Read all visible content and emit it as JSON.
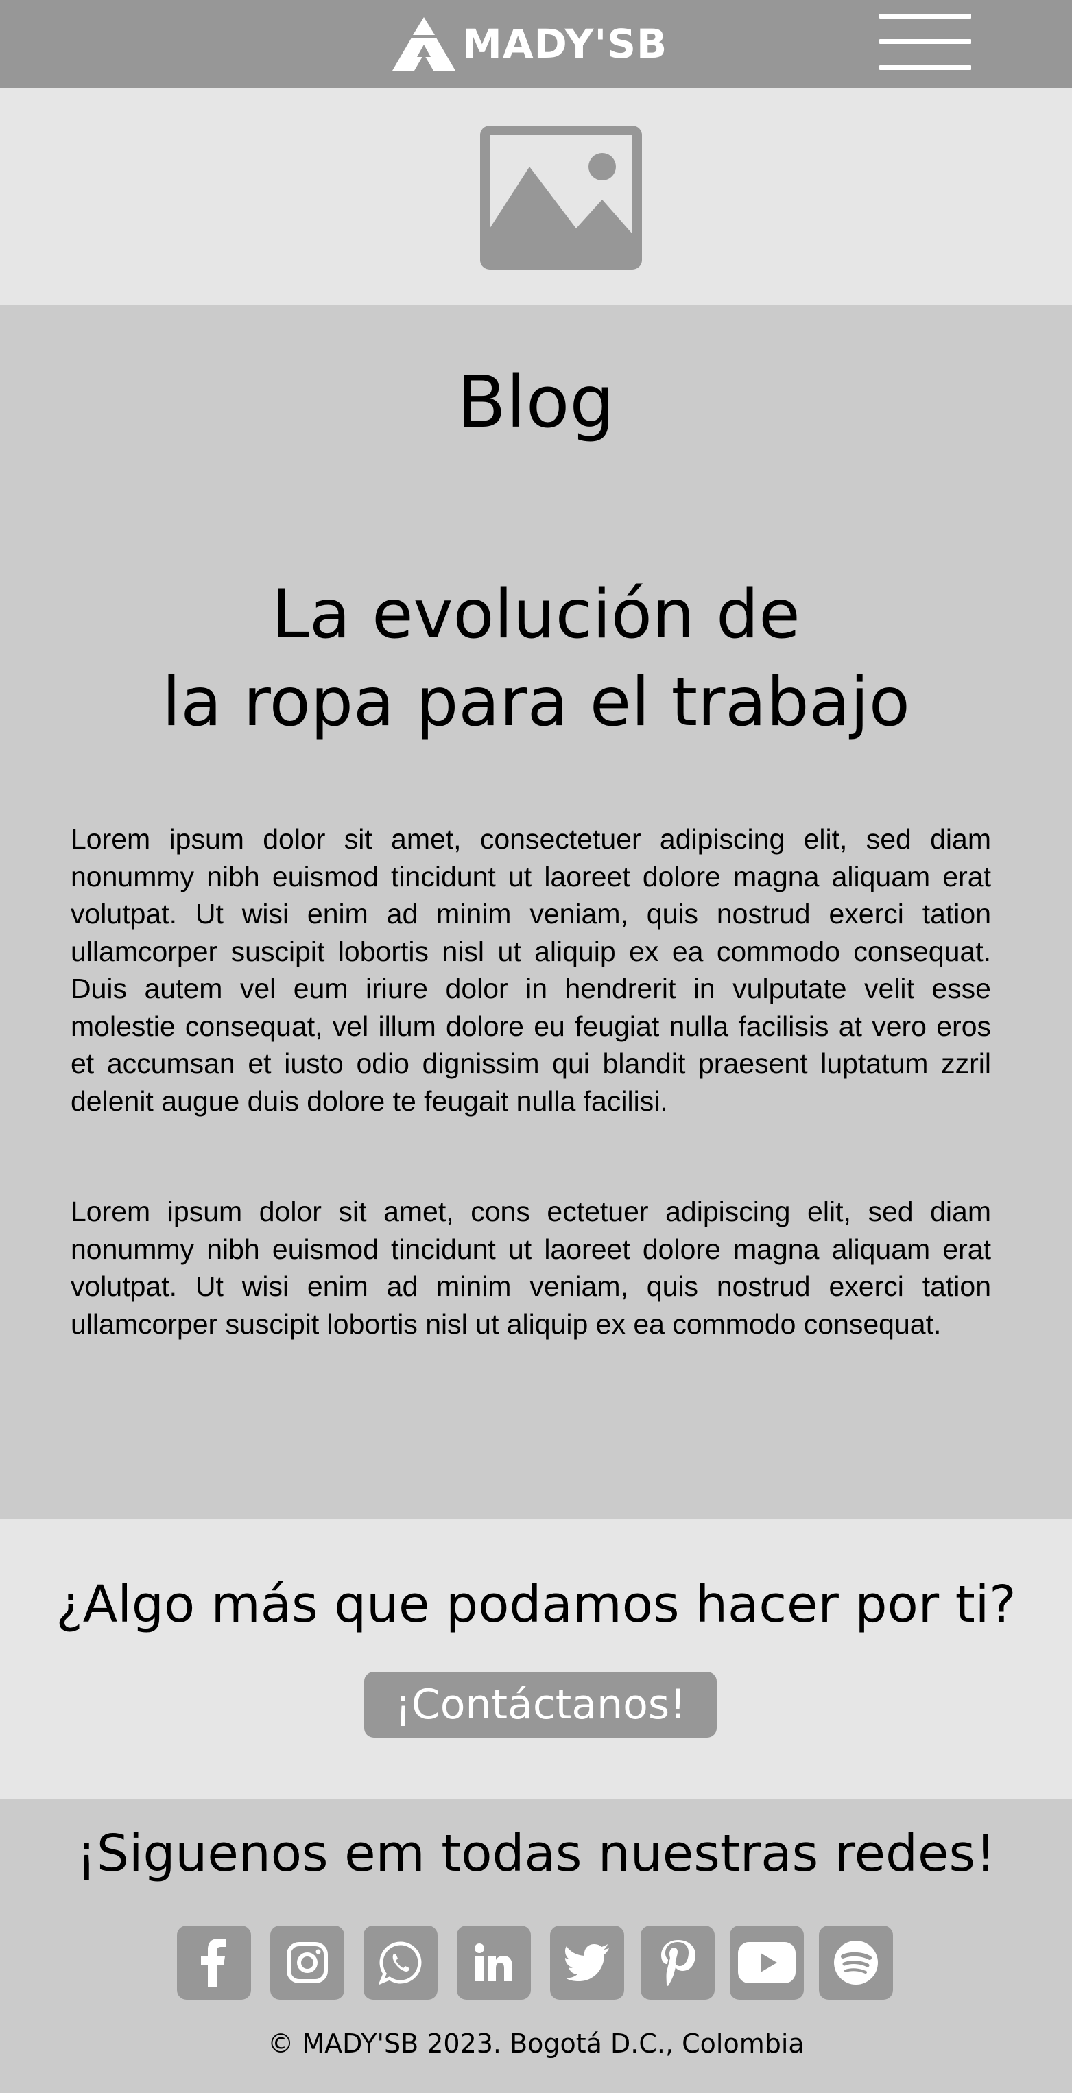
{
  "header": {
    "brand": "MADY'SB",
    "logo_icon": "mountain-logo-icon",
    "menu_icon": "hamburger-menu-icon"
  },
  "hero": {
    "image_icon": "image-placeholder-icon"
  },
  "blog": {
    "label": "Blog",
    "title_line1": "La evolución de",
    "title_line2": "la ropa para el trabajo",
    "paragraph1": "Lorem ipsum dolor sit amet, consectetuer adipiscing elit, sed diam nonummy nibh euismod tincidunt ut laoreet dolore magna aliquam erat volutpat. Ut wisi enim ad minim veniam, quis nostrud exerci tation ullamcorper suscipit lobortis nisl ut aliquip ex ea commodo consequat. Duis autem vel eum iriure dolor in hendrerit in vulputate velit esse molestie consequat, vel illum dolore eu feugiat nulla facilisis at vero eros et accumsan et iusto odio dignissim qui blandit praesent luptatum zzril delenit augue duis dolore te feugait nulla facilisi.",
    "paragraph2": "Lorem ipsum dolor sit amet, cons ectetuer adipiscing elit, sed diam nonummy nibh euismod tincidunt ut laoreet dolore magna aliquam erat volutpat. Ut wisi enim ad minim veniam, quis nostrud exerci tation ullamcorper suscipit lobortis nisl ut aliquip ex ea commodo consequat."
  },
  "cta": {
    "title": "¿Algo más que podamos hacer por ti?",
    "button_label": "¡Contáctanos!"
  },
  "social": {
    "title": "¡Siguenos em todas nuestras redes!",
    "icons": [
      "facebook-icon",
      "instagram-icon",
      "whatsapp-icon",
      "linkedin-icon",
      "twitter-icon",
      "pinterest-icon",
      "youtube-icon",
      "spotify-icon"
    ],
    "footer": "© MADY'SB 2023. Bogotá D.C., Colombia"
  },
  "colors": {
    "dark_gray": "#979797",
    "light_gray": "#e6e6e6",
    "mid_gray": "#cbcbcb",
    "white": "#ffffff"
  }
}
